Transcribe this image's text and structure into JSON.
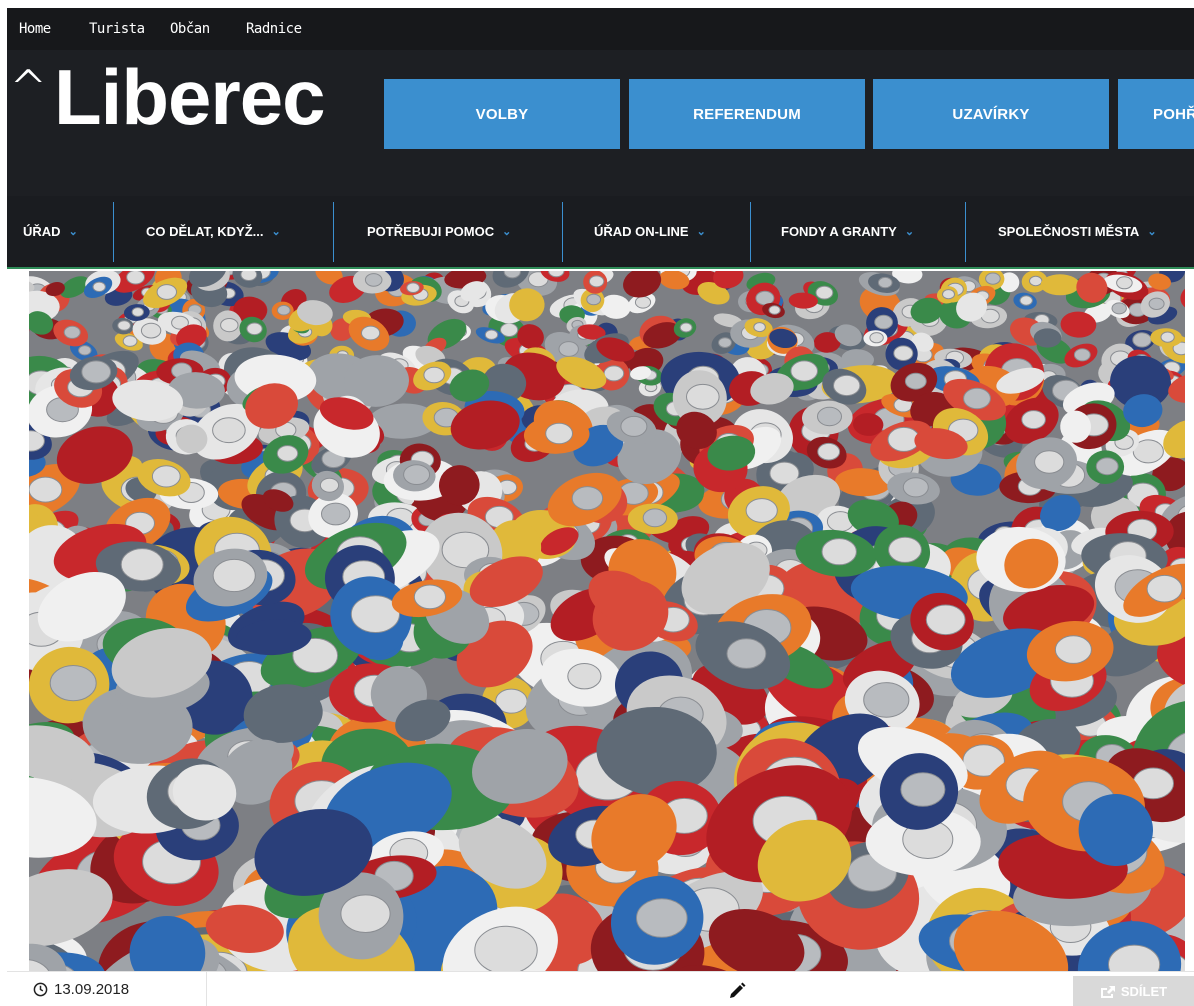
{
  "topbar": {
    "links": [
      "Home",
      "Turista",
      "Občan",
      "Radnice"
    ]
  },
  "logo": {
    "caret": "^",
    "text": "Liberec"
  },
  "quick_buttons": [
    "VOLBY",
    "REFERENDUM",
    "UZAVÍRKY",
    "POHŘ"
  ],
  "main_nav": [
    {
      "label": "ÚŘAD"
    },
    {
      "label": "CO DĚLAT, KDYŽ..."
    },
    {
      "label": "POTŘEBUJI POMOC"
    },
    {
      "label": "ÚŘAD ON-LINE"
    },
    {
      "label": "FONDY A GRANTY"
    },
    {
      "label": "SPOLEČNOSTI MĚSTA"
    }
  ],
  "nav_chevron": "⌄",
  "article": {
    "date": "13.09.2018",
    "share_label": "SDÍLET"
  },
  "icons": {
    "clock": "clock-icon",
    "pencil": "pencil-icon",
    "share": "share-icon"
  },
  "colors": {
    "header_bg": "#1d1f23",
    "accent_blue": "#3b8fcf",
    "nav_underline": "#2e8b57"
  }
}
